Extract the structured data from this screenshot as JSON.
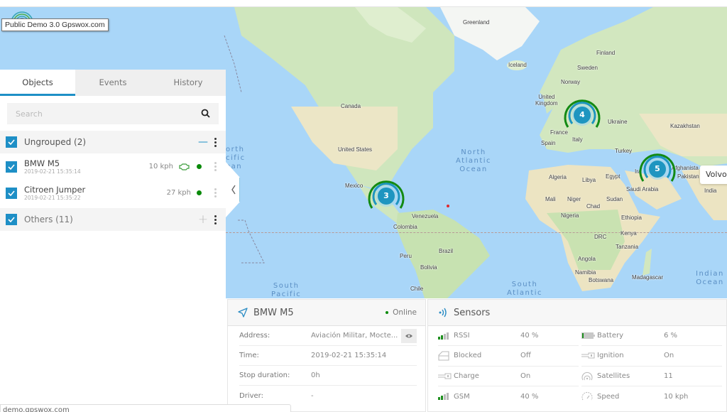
{
  "site_tooltip": "Public Demo 3.0 Gpswox.com",
  "left_panel": {
    "tabs": [
      {
        "label": "Objects",
        "active": true
      },
      {
        "label": "Events",
        "active": false
      },
      {
        "label": "History",
        "active": false
      }
    ],
    "search": {
      "placeholder": "Search",
      "value": ""
    },
    "groups": [
      {
        "label": "Ungrouped (2)",
        "checked": true,
        "expanded": true,
        "objects": [
          {
            "name": "BMW M5",
            "time": "2019-02-21 15:35:14",
            "speed": "10 kph",
            "engine_on": true,
            "online": true
          },
          {
            "name": "Citroen Jumper",
            "time": "2019-02-21 15:35:22",
            "speed": "27 kph",
            "engine_on": false,
            "online": true
          }
        ]
      },
      {
        "label": "Others (11)",
        "checked": true,
        "expanded": false,
        "objects": []
      }
    ]
  },
  "map": {
    "labels": {
      "greenland": "Greenland",
      "iceland": "Iceland",
      "finland": "Finland",
      "sweden": "Sweden",
      "norway": "Norway",
      "uk": "United\nKingdom",
      "france": "France",
      "spain": "Spain",
      "italy": "Italy",
      "ukraine": "Ukraine",
      "kazakhstan": "Kazakhstan",
      "turkey": "Turkey",
      "canada": "Canada",
      "us": "United States",
      "mexico": "Mexico",
      "venezuela": "Venezuela",
      "colombia": "Colombia",
      "peru": "Peru",
      "brazil": "Brazil",
      "bolivia": "Bolivia",
      "chile": "Chile",
      "algeria": "Algeria",
      "libya": "Libya",
      "egypt": "Egypt",
      "mali": "Mali",
      "niger": "Niger",
      "chad": "Chad",
      "sudan": "Sudan",
      "nigeria": "Nigeria",
      "ethiopia": "Ethiopia",
      "drc": "DRC",
      "kenya": "Kenya",
      "tanzania": "Tanzania",
      "angola": "Angola",
      "namibia": "Namibia",
      "botswana": "Botswana",
      "madagascar": "Madagascar",
      "saudi": "Saudi Arabia",
      "afghanistan": "Afghanista",
      "pakistan": "Pakistan",
      "india": "India",
      "iraq": "Ira"
    },
    "oceans": {
      "north_pacific": "orth\ncific\nean",
      "north_atlantic": "North\nAtlantic\nOcean",
      "south_pacific": "South\nPacific",
      "south_atlantic": "South\nAtlantic",
      "indian": "Indian\nOcean"
    },
    "clusters": [
      {
        "region": "Americas",
        "count": "3"
      },
      {
        "region": "Europe",
        "count": "4"
      },
      {
        "region": "Middle East",
        "count": "5"
      }
    ],
    "marker_tooltip": "Volvo"
  },
  "object_info": {
    "title": "BMW M5",
    "status": "Online",
    "rows": [
      {
        "label": "Address:",
        "value": "Aviación Militar, Mocte..."
      },
      {
        "label": "Time:",
        "value": "2019-02-21 15:35:14"
      },
      {
        "label": "Stop duration:",
        "value": "0h"
      },
      {
        "label": "Driver:",
        "value": "-"
      }
    ]
  },
  "sensors": {
    "title": "Sensors",
    "items": [
      {
        "icon": "signal-icon",
        "label": "RSSI",
        "value": "40 %"
      },
      {
        "icon": "battery-icon",
        "label": "Battery",
        "value": "6 %"
      },
      {
        "icon": "door-icon",
        "label": "Blocked",
        "value": "Off"
      },
      {
        "icon": "key-icon",
        "label": "Ignition",
        "value": "On"
      },
      {
        "icon": "key-icon",
        "label": "Charge",
        "value": "On"
      },
      {
        "icon": "satellite-icon",
        "label": "Satellites",
        "value": "11"
      },
      {
        "icon": "signal-icon",
        "label": "GSM",
        "value": "40 %"
      },
      {
        "icon": "speedometer-icon",
        "label": "Speed",
        "value": "10 kph"
      }
    ]
  },
  "statusbar": "demo.gpswox.com",
  "colors": {
    "accent": "#1e8fc6",
    "online": "#0a8a0a",
    "cluster_ring": "#138a13",
    "cluster_fill": "#1e95c0"
  }
}
